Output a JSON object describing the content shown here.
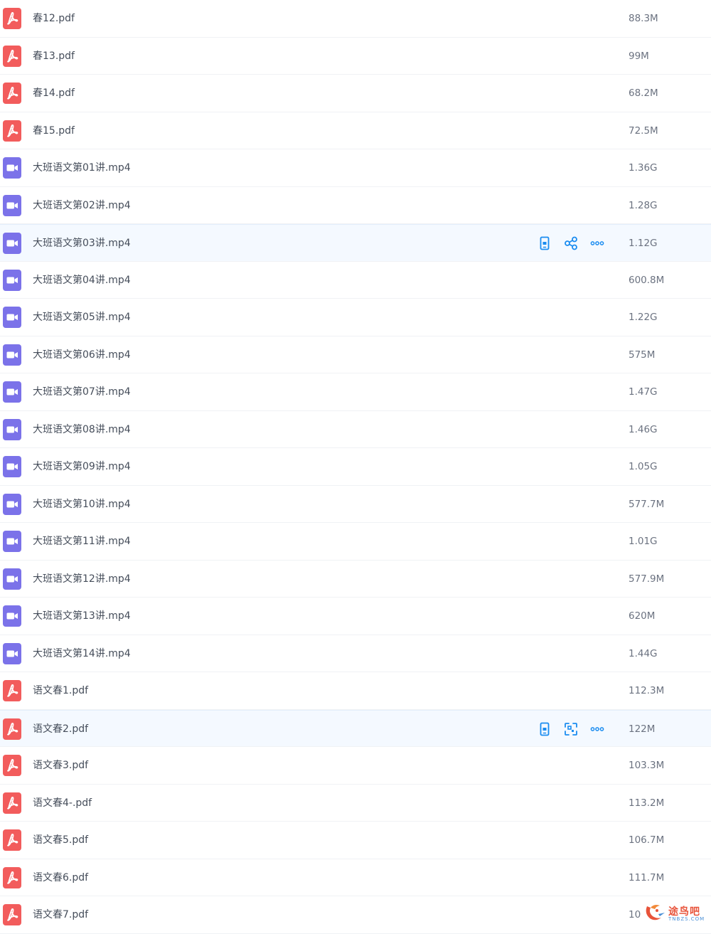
{
  "files": [
    {
      "name": "春12.pdf",
      "size": "88.3M",
      "type": "pdf",
      "icon": "pdf-file-icon",
      "hovered": false
    },
    {
      "name": "春13.pdf",
      "size": "99M",
      "type": "pdf",
      "icon": "pdf-file-icon",
      "hovered": false
    },
    {
      "name": "春14.pdf",
      "size": "68.2M",
      "type": "pdf",
      "icon": "pdf-file-icon",
      "hovered": false
    },
    {
      "name": "春15.pdf",
      "size": "72.5M",
      "type": "pdf",
      "icon": "pdf-file-icon",
      "hovered": false
    },
    {
      "name": "大班语文第01讲.mp4",
      "size": "1.36G",
      "type": "video",
      "icon": "video-file-icon",
      "hovered": false
    },
    {
      "name": "大班语文第02讲.mp4",
      "size": "1.28G",
      "type": "video",
      "icon": "video-file-icon",
      "hovered": false
    },
    {
      "name": "大班语文第03讲.mp4",
      "size": "1.12G",
      "type": "video",
      "icon": "video-file-icon",
      "hovered": true,
      "actions": [
        {
          "name": "send-to-phone-button",
          "icon": "phone-icon"
        },
        {
          "name": "share-button",
          "icon": "share-icon"
        },
        {
          "name": "more-button",
          "icon": "more-dots-icon"
        }
      ]
    },
    {
      "name": "大班语文第04讲.mp4",
      "size": "600.8M",
      "type": "video",
      "icon": "video-file-icon",
      "hovered": false
    },
    {
      "name": "大班语文第05讲.mp4",
      "size": "1.22G",
      "type": "video",
      "icon": "video-file-icon",
      "hovered": false
    },
    {
      "name": "大班语文第06讲.mp4",
      "size": "575M",
      "type": "video",
      "icon": "video-file-icon",
      "hovered": false
    },
    {
      "name": "大班语文第07讲.mp4",
      "size": "1.47G",
      "type": "video",
      "icon": "video-file-icon",
      "hovered": false
    },
    {
      "name": "大班语文第08讲.mp4",
      "size": "1.46G",
      "type": "video",
      "icon": "video-file-icon",
      "hovered": false
    },
    {
      "name": "大班语文第09讲.mp4",
      "size": "1.05G",
      "type": "video",
      "icon": "video-file-icon",
      "hovered": false
    },
    {
      "name": "大班语文第10讲.mp4",
      "size": "577.7M",
      "type": "video",
      "icon": "video-file-icon",
      "hovered": false
    },
    {
      "name": "大班语文第11讲.mp4",
      "size": "1.01G",
      "type": "video",
      "icon": "video-file-icon",
      "hovered": false
    },
    {
      "name": "大班语文第12讲.mp4",
      "size": "577.9M",
      "type": "video",
      "icon": "video-file-icon",
      "hovered": false
    },
    {
      "name": "大班语文第13讲.mp4",
      "size": "620M",
      "type": "video",
      "icon": "video-file-icon",
      "hovered": false
    },
    {
      "name": "大班语文第14讲.mp4",
      "size": "1.44G",
      "type": "video",
      "icon": "video-file-icon",
      "hovered": false
    },
    {
      "name": "语文春1.pdf",
      "size": "112.3M",
      "type": "pdf",
      "icon": "pdf-file-icon",
      "hovered": false
    },
    {
      "name": "语文春2.pdf",
      "size": "122M",
      "type": "pdf",
      "icon": "pdf-file-icon",
      "hovered": true,
      "actions": [
        {
          "name": "send-to-phone-button",
          "icon": "phone-icon"
        },
        {
          "name": "scan-button",
          "icon": "scan-icon"
        },
        {
          "name": "more-button",
          "icon": "more-dots-icon"
        }
      ]
    },
    {
      "name": "语文春3.pdf",
      "size": "103.3M",
      "type": "pdf",
      "icon": "pdf-file-icon",
      "hovered": false
    },
    {
      "name": "语文春4-.pdf",
      "size": "113.2M",
      "type": "pdf",
      "icon": "pdf-file-icon",
      "hovered": false
    },
    {
      "name": "语文春5.pdf",
      "size": "106.7M",
      "type": "pdf",
      "icon": "pdf-file-icon",
      "hovered": false
    },
    {
      "name": "语文春6.pdf",
      "size": "111.7M",
      "type": "pdf",
      "icon": "pdf-file-icon",
      "hovered": false
    },
    {
      "name": "语文春7.pdf",
      "size": "10",
      "type": "pdf",
      "icon": "pdf-file-icon",
      "hovered": false
    }
  ],
  "watermark": {
    "text": "途鸟吧",
    "sub": "TNBZS.COM"
  },
  "colors": {
    "pdf": "#f25c5c",
    "video": "#7b72e9",
    "accent": "#1a8cf0",
    "hover_bg": "#f4f9ff"
  }
}
